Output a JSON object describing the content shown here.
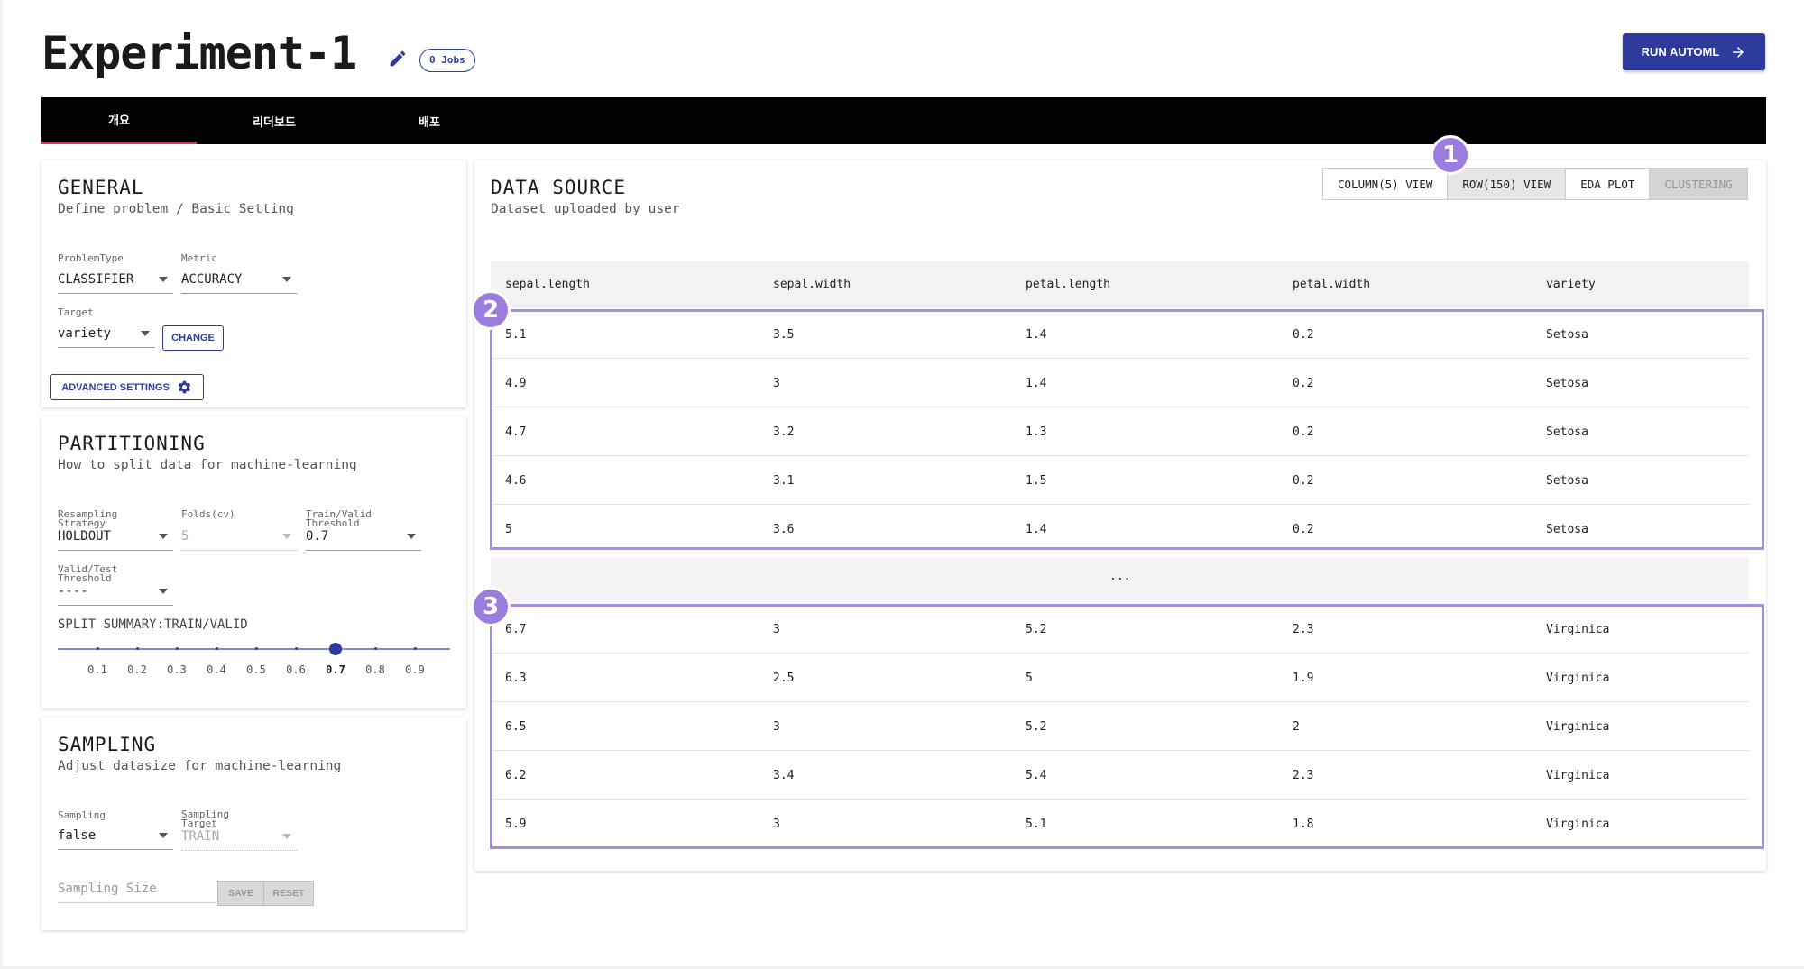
{
  "header": {
    "title": "Experiment-1",
    "jobs_badge": "0 Jobs",
    "run_button": "RUN AUTOML"
  },
  "tabs": [
    {
      "label": "개요",
      "active": true
    },
    {
      "label": "리더보드",
      "active": false
    },
    {
      "label": "배포",
      "active": false
    }
  ],
  "general": {
    "title": "GENERAL",
    "subtitle": "Define problem / Basic Setting",
    "problem_type_label": "ProblemType",
    "problem_type_value": "CLASSIFIER",
    "metric_label": "Metric",
    "metric_value": "ACCURACY",
    "target_label": "Target",
    "target_value": "variety",
    "change_button": "CHANGE",
    "advanced_button": "ADVANCED SETTINGS"
  },
  "partitioning": {
    "title": "PARTITIONING",
    "subtitle": "How to split data for machine-learning",
    "resampling_label_1": "Resampling",
    "resampling_label_2": "Strategy",
    "resampling_value": "HOLDOUT",
    "folds_label": "Folds(cv)",
    "folds_value": "5",
    "train_valid_label_1": "Train/Valid",
    "train_valid_label_2": "Threshold",
    "train_valid_value": "0.7",
    "valid_test_label_1": "Valid/Test",
    "valid_test_label_2": "Threshold",
    "valid_test_value": "----",
    "split_summary": "SPLIT SUMMARY:TRAIN/VALID",
    "slider_ticks": [
      "0.1",
      "0.2",
      "0.3",
      "0.4",
      "0.5",
      "0.6",
      "0.7",
      "0.8",
      "0.9"
    ],
    "slider_value": 0.7
  },
  "sampling": {
    "title": "SAMPLING",
    "subtitle": "Adjust datasize for machine-learning",
    "sampling_label": "Sampling",
    "sampling_value": "false",
    "target_label_1": "Sampling",
    "target_label_2": "Target",
    "target_value": "TRAIN",
    "size_placeholder": "Sampling Size",
    "save_button": "SAVE",
    "reset_button": "RESET"
  },
  "data_source": {
    "title": "DATA SOURCE",
    "subtitle": "Dataset uploaded by user",
    "view_buttons": [
      "COLUMN(5) VIEW",
      "ROW(150) VIEW",
      "EDA PLOT",
      "CLUSTERING"
    ],
    "columns": [
      "sepal.length",
      "sepal.width",
      "petal.length",
      "petal.width",
      "variety"
    ],
    "top_rows": [
      [
        "5.1",
        "3.5",
        "1.4",
        "0.2",
        "Setosa"
      ],
      [
        "4.9",
        "3",
        "1.4",
        "0.2",
        "Setosa"
      ],
      [
        "4.7",
        "3.2",
        "1.3",
        "0.2",
        "Setosa"
      ],
      [
        "4.6",
        "3.1",
        "1.5",
        "0.2",
        "Setosa"
      ],
      [
        "5",
        "3.6",
        "1.4",
        "0.2",
        "Setosa"
      ]
    ],
    "ellipsis": "...",
    "bottom_rows": [
      [
        "6.7",
        "3",
        "5.2",
        "2.3",
        "Virginica"
      ],
      [
        "6.3",
        "2.5",
        "5",
        "1.9",
        "Virginica"
      ],
      [
        "6.5",
        "3",
        "5.2",
        "2",
        "Virginica"
      ],
      [
        "6.2",
        "3.4",
        "5.4",
        "2.3",
        "Virginica"
      ],
      [
        "5.9",
        "3",
        "5.1",
        "1.8",
        "Virginica"
      ]
    ]
  },
  "markers": [
    "1",
    "2",
    "3"
  ],
  "colors": {
    "primary": "#2d3b9c",
    "tab_active": "#e0315c",
    "highlight": "#a98ae6",
    "marker": "#9b7de0"
  }
}
